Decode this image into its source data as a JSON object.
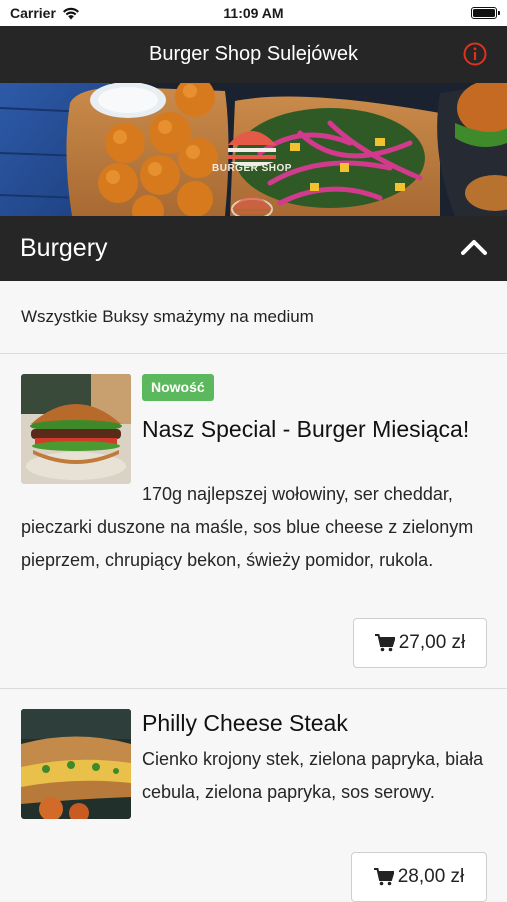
{
  "status_bar": {
    "carrier": "Carrier",
    "time": "11:09 AM"
  },
  "nav": {
    "title": "Burger Shop Sulejówek",
    "info_icon": "info-circle-icon",
    "accent_color": "#e0301e"
  },
  "banner": {
    "logo_text": "BURGER SHOP"
  },
  "section": {
    "title": "Burgery",
    "note": "Wszystkie Buksy smażymy na medium",
    "toggle_icon": "chevron-up-icon"
  },
  "items": [
    {
      "badge": "Nowość",
      "name": "Nasz Special - Burger Miesiąca!",
      "desc_first": "170g najlepszej wołowiny, ser cheddar,",
      "desc_rest": "pieczarki duszone na maśle, sos blue cheese z zielonym pieprzem, chrupiący bekon, świeży pomidor, rukola.",
      "price": "27,00 zł"
    },
    {
      "name": "Philly Cheese Steak",
      "desc": "Cienko krojony stek, zielona papryka, biała cebula, zielona papryka, sos serowy.",
      "price": "28,00 zł"
    }
  ],
  "colors": {
    "header_bg": "#262626",
    "badge_green": "#5cb85c",
    "page_bg": "#f7f7f7"
  }
}
